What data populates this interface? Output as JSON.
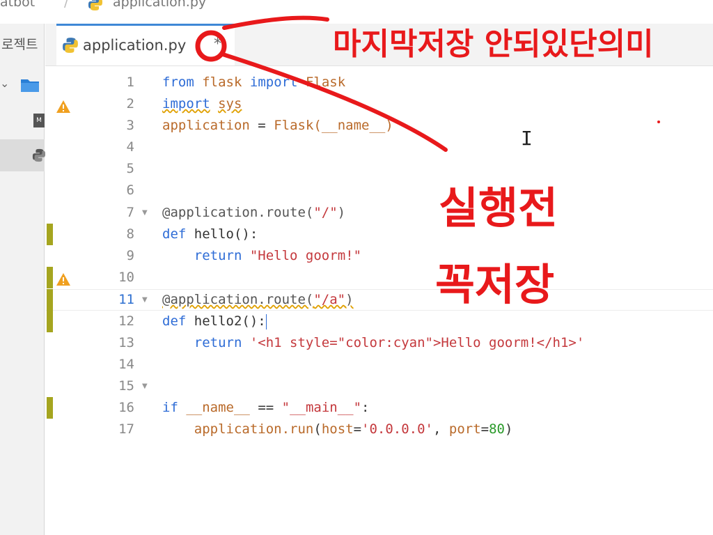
{
  "breadcrumb": {
    "project": "atbot",
    "separator": "/",
    "file": "application.py"
  },
  "sidebar": {
    "tab_label": "로젝트"
  },
  "editor": {
    "tab": {
      "label": "application.py",
      "modified_marker": "*"
    },
    "lines": [
      {
        "n": "1"
      },
      {
        "n": "2"
      },
      {
        "n": "3"
      },
      {
        "n": "4"
      },
      {
        "n": "5"
      },
      {
        "n": "6"
      },
      {
        "n": "7"
      },
      {
        "n": "8"
      },
      {
        "n": "9"
      },
      {
        "n": "10"
      },
      {
        "n": "11"
      },
      {
        "n": "12"
      },
      {
        "n": "13"
      },
      {
        "n": "14"
      },
      {
        "n": "15"
      },
      {
        "n": "16"
      },
      {
        "n": "17"
      }
    ]
  },
  "annotations": {
    "text_top": "마지막저장 안되있단의미",
    "text_bottom_1": "실행전",
    "text_bottom_2": "꼭저장",
    "color": "#e8191b"
  },
  "colors": {
    "accent": "#3f88d6",
    "keyword": "#2e6cd6",
    "string": "#c4383c",
    "identifier": "#b96a2a",
    "warning": "#e0a000",
    "change_marker": "#a5a51f"
  }
}
